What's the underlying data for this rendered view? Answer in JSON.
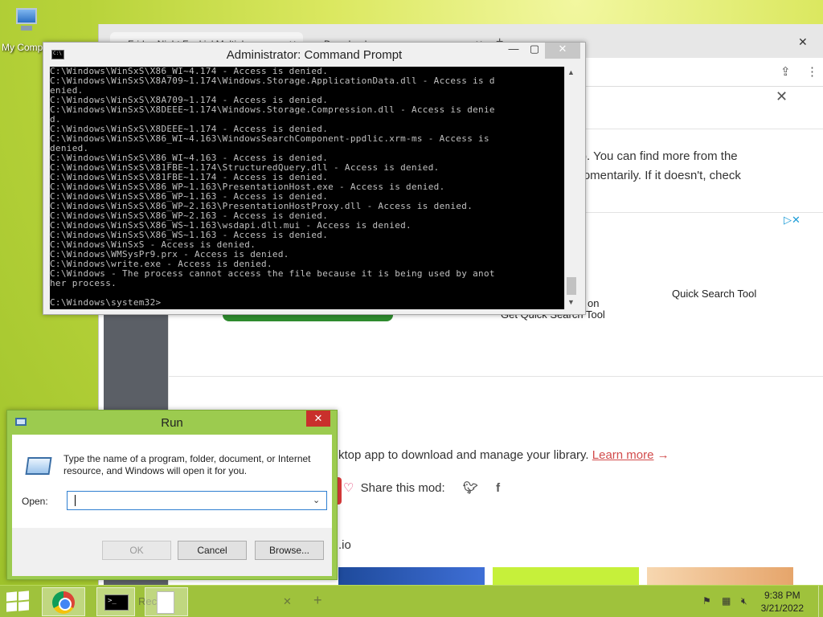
{
  "desktop": {
    "icon_label": "My Comp"
  },
  "browser": {
    "tabs": [
      {
        "label": "Friday Night Funkin' Multiplay"
      },
      {
        "label": "Downloads"
      }
    ],
    "page": {
      "text1": "ario. You can find more from the",
      "text2": "t momentarily. If it doesn't, check",
      "ad_title": "Quick Search Tool",
      "ad_line1": "on",
      "ad_line2": "Get Quick Search Tool",
      "desktop_app_text": "ktop app to download and manage your library.",
      "learn_more": "Learn more",
      "arrow": "→",
      "share_label": "Share this mod:",
      "section_text": ".io"
    }
  },
  "cmd": {
    "title": "Administrator: Command Prompt",
    "lines": [
      "C:\\Windows\\WinSxS\\X86_WI~4.174 - Access is denied.",
      "C:\\Windows\\WinSxS\\X8A709~1.174\\Windows.Storage.ApplicationData.dll - Access is d",
      "enied.",
      "C:\\Windows\\WinSxS\\X8A709~1.174 - Access is denied.",
      "C:\\Windows\\WinSxS\\X8DEEE~1.174\\Windows.Storage.Compression.dll - Access is denie",
      "d.",
      "C:\\Windows\\WinSxS\\X8DEEE~1.174 - Access is denied.",
      "C:\\Windows\\WinSxS\\X86_WI~4.163\\WindowsSearchComponent-ppdlic.xrm-ms - Access is",
      "denied.",
      "C:\\Windows\\WinSxS\\X86_WI~4.163 - Access is denied.",
      "C:\\Windows\\WinSxS\\X81FBE~1.174\\StructuredQuery.dll - Access is denied.",
      "C:\\Windows\\WinSxS\\X81FBE~1.174 - Access is denied.",
      "C:\\Windows\\WinSxS\\X86_WP~1.163\\PresentationHost.exe - Access is denied.",
      "C:\\Windows\\WinSxS\\X86_WP~1.163 - Access is denied.",
      "C:\\Windows\\WinSxS\\X86_WP~2.163\\PresentationHostProxy.dll - Access is denied.",
      "C:\\Windows\\WinSxS\\X86_WP~2.163 - Access is denied.",
      "C:\\Windows\\WinSxS\\X86_WS~1.163\\wsdapi.dll.mui - Access is denied.",
      "C:\\Windows\\WinSxS\\X86_WS~1.163 - Access is denied.",
      "C:\\Windows\\WinSxS - Access is denied.",
      "C:\\Windows\\WMSysPr9.prx - Access is denied.",
      "C:\\Windows\\write.exe - Access is denied.",
      "C:\\Windows - The process cannot access the file because it is being used by anot",
      "her process.",
      "",
      "C:\\Windows\\system32>"
    ]
  },
  "run": {
    "title": "Run",
    "description": "Type the name of a program, folder, document, or Internet resource, and Windows will open it for you.",
    "open_label": "Open:",
    "open_value": "",
    "ok_label": "OK",
    "cancel_label": "Cancel",
    "browse_label": "Browse..."
  },
  "taskbar": {
    "ghost_label": "Rec",
    "time": "9:38 PM",
    "date": "3/21/2022"
  },
  "colors": {
    "taskbar": "#9fc23c",
    "run_frame": "#9ccb4f",
    "close_red": "#c9302c",
    "link": "#d24b4b"
  }
}
